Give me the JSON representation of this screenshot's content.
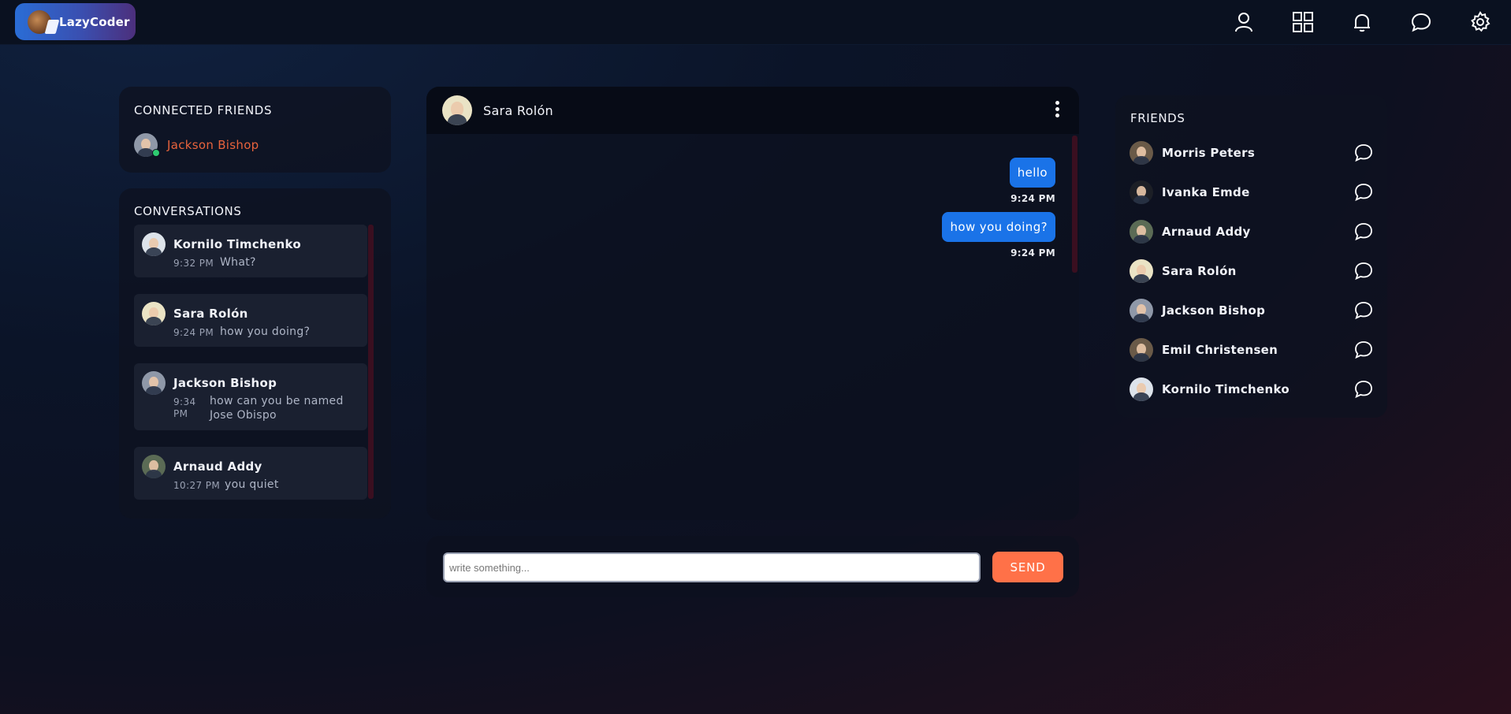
{
  "app": {
    "logo_text": "LazyCoder"
  },
  "nav": {
    "icons": [
      "user-icon",
      "grid-icon",
      "bell-icon",
      "chat-icon",
      "gear-icon"
    ]
  },
  "connected_friends": {
    "title": "CONNECTED FRIENDS",
    "items": [
      {
        "name": "Jackson Bishop",
        "status": "online"
      }
    ]
  },
  "conversations": {
    "title": "CONVERSATIONS",
    "items": [
      {
        "name": "Kornilo Timchenko",
        "time": "9:32 PM",
        "message": "What?"
      },
      {
        "name": "Sara Rolón",
        "time": "9:24 PM",
        "message": "how you doing?"
      },
      {
        "name": "Jackson Bishop",
        "time_line1": "9:34",
        "time_line2": "PM",
        "message_line1": "how can you be named",
        "message_line2": "Jose Obispo"
      },
      {
        "name": "Arnaud Addy",
        "time": "10:27 PM",
        "message": "you quiet"
      }
    ]
  },
  "chat": {
    "contact_name": "Sara Rolón",
    "messages": [
      {
        "text": "hello",
        "time": "9:24 PM",
        "sender": "me"
      },
      {
        "text": "how you doing?",
        "time": "9:24 PM",
        "sender": "me"
      }
    ]
  },
  "composer": {
    "placeholder": "write something...",
    "value": "",
    "send_label": "SEND"
  },
  "friends": {
    "title": "FRIENDS",
    "items": [
      {
        "name": "Morris Peters"
      },
      {
        "name": "Ivanka Emde"
      },
      {
        "name": "Arnaud Addy"
      },
      {
        "name": "Sara Rolón"
      },
      {
        "name": "Jackson Bishop"
      },
      {
        "name": "Emil Christensen"
      },
      {
        "name": "Kornilo Timchenko"
      }
    ]
  },
  "colors": {
    "accent_blue": "#1a73e8",
    "send_orange": "#ff7148",
    "online_green": "#2ecc71",
    "highlight_name": "#e8633c"
  }
}
